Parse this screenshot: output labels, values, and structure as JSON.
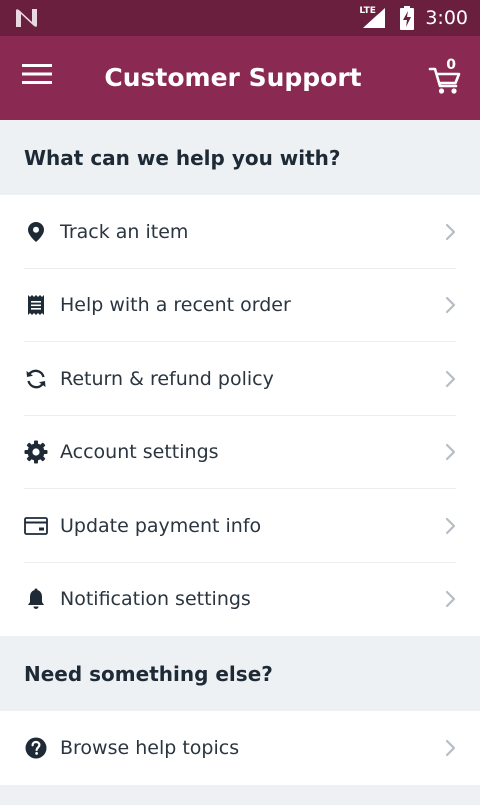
{
  "status_bar": {
    "time": "3:00",
    "network": "LTE",
    "icons": [
      "notification-n-icon",
      "lte-signal-icon",
      "battery-charging-icon"
    ]
  },
  "app_bar": {
    "title": "Customer Support",
    "cart_count": "0",
    "icons": [
      "menu-icon",
      "cart-icon"
    ]
  },
  "sections": [
    {
      "header": "What can we help you with?",
      "items": [
        {
          "label": "Track an item",
          "icon": "location-pin-icon"
        },
        {
          "label": "Help with a recent order",
          "icon": "receipt-icon"
        },
        {
          "label": "Return & refund policy",
          "icon": "refresh-icon"
        },
        {
          "label": "Account settings",
          "icon": "gear-icon"
        },
        {
          "label": "Update payment info",
          "icon": "credit-card-icon"
        },
        {
          "label": "Notification settings",
          "icon": "bell-icon"
        }
      ]
    },
    {
      "header": "Need something else?",
      "items": [
        {
          "label": "Browse help topics",
          "icon": "help-circle-icon"
        }
      ]
    }
  ],
  "colors": {
    "status_bar": "#6b1f3f",
    "app_bar": "#8a2a52",
    "background": "#eef1f4",
    "text": "#2b3540",
    "header_text": "#1e2a36",
    "chevron": "#b7bdc4"
  }
}
